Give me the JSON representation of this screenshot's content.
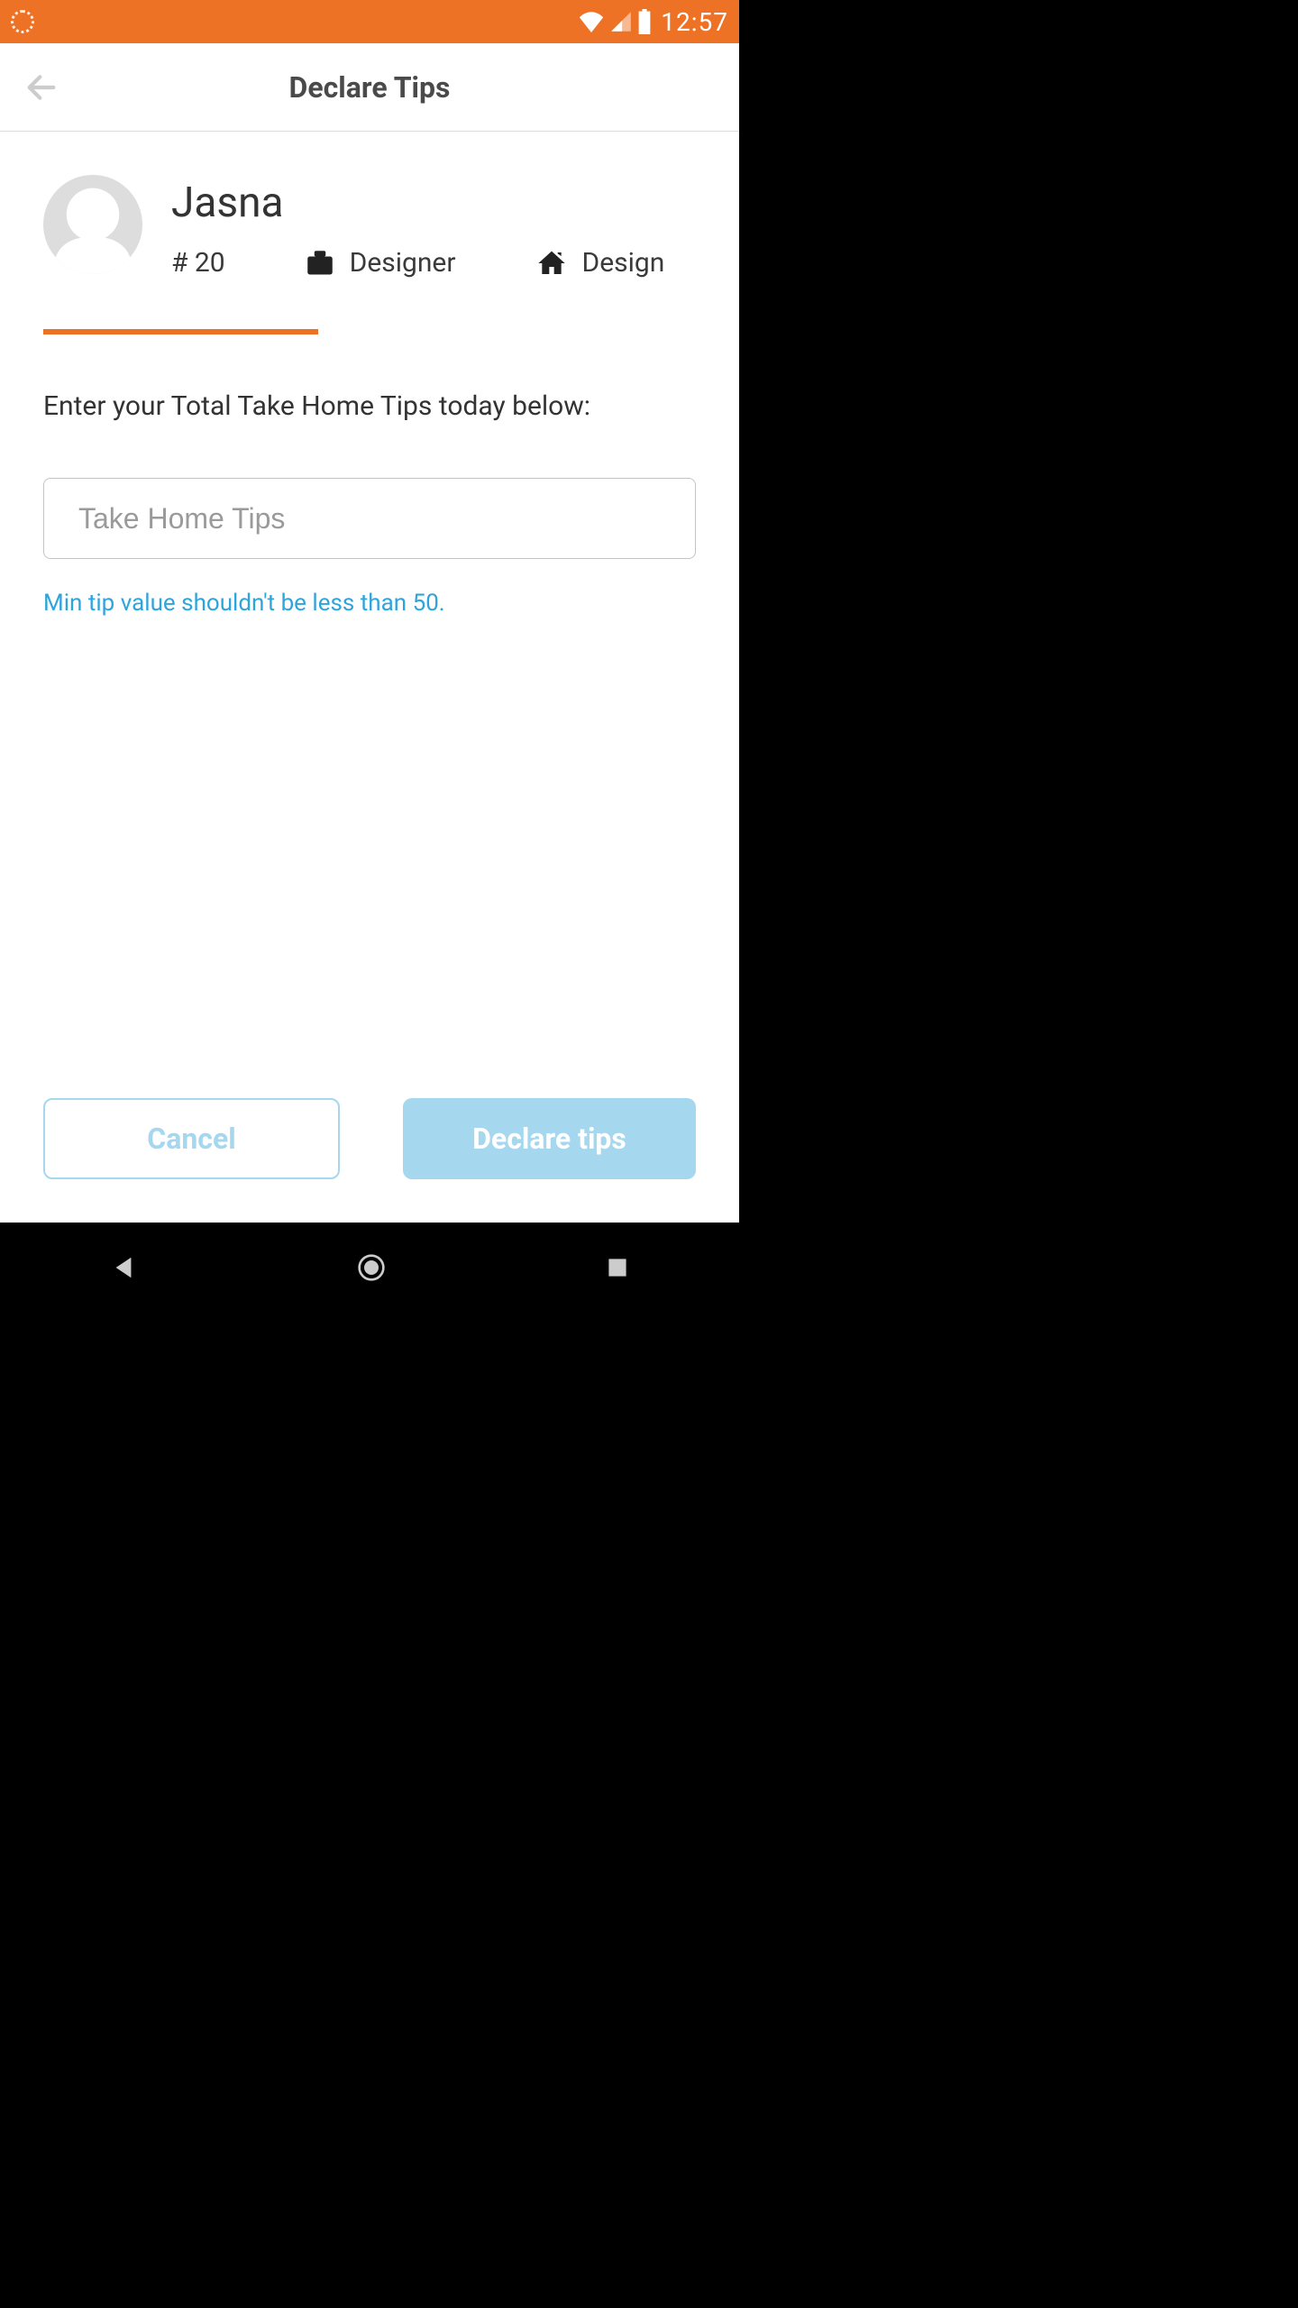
{
  "status": {
    "time": "12:57"
  },
  "header": {
    "title": "Declare Tips"
  },
  "profile": {
    "name": "Jasna",
    "employee_number": "# 20",
    "role": "Designer",
    "department": "Design"
  },
  "form": {
    "prompt": "Enter your Total Take Home Tips today below:",
    "placeholder": "Take Home Tips",
    "value": "",
    "hint": "Min tip value shouldn't be less than 50."
  },
  "actions": {
    "cancel": "Cancel",
    "submit": "Declare tips"
  }
}
